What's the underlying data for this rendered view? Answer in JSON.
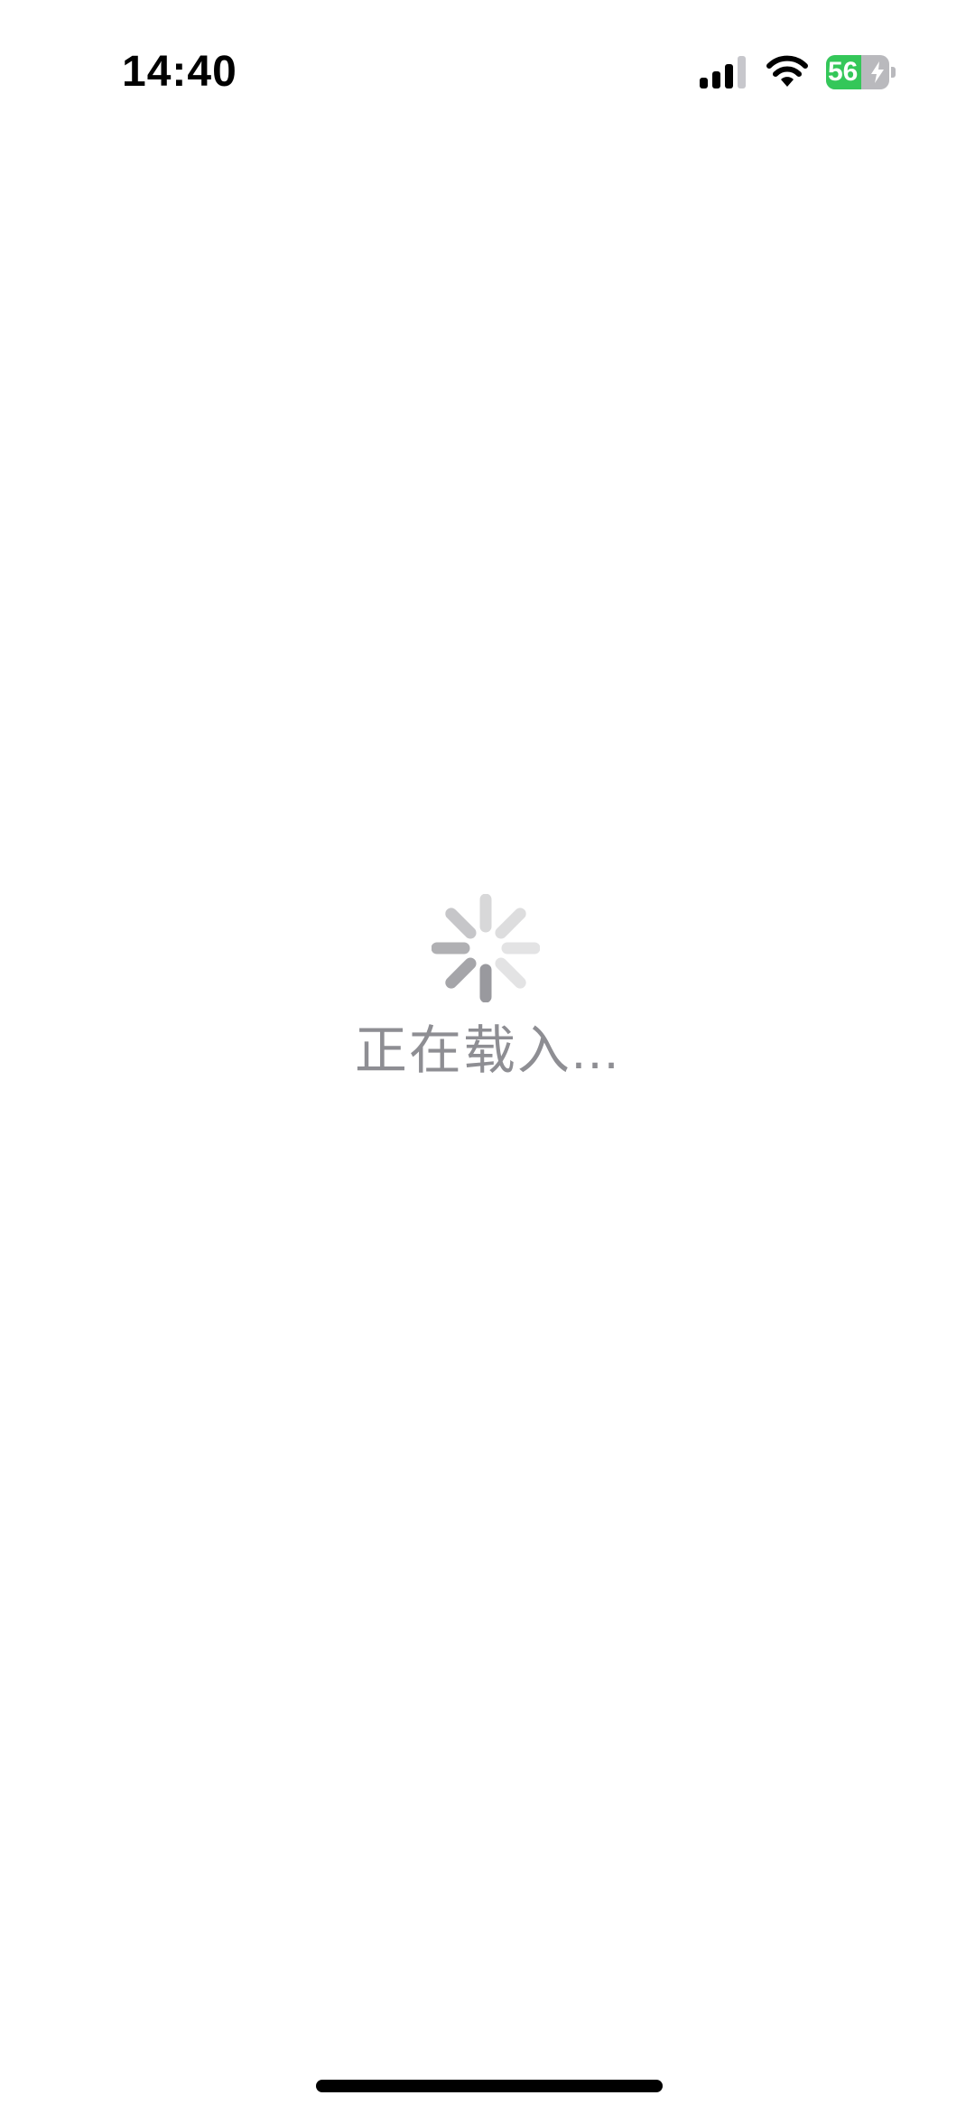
{
  "status_bar": {
    "time": "14:40",
    "battery_level": "56",
    "battery_fraction": 0.56,
    "battery_color": "#34c759",
    "signal_icon": "cellular-signal-icon",
    "wifi_icon": "wifi-icon",
    "charging_icon": "lightning-bolt-icon"
  },
  "loading": {
    "spinner_icon": "activity-spinner-icon",
    "label": "正在载入..."
  },
  "colors": {
    "background": "#ffffff",
    "loading_text": "#8e8e93",
    "spinner": "#8e8e93"
  }
}
